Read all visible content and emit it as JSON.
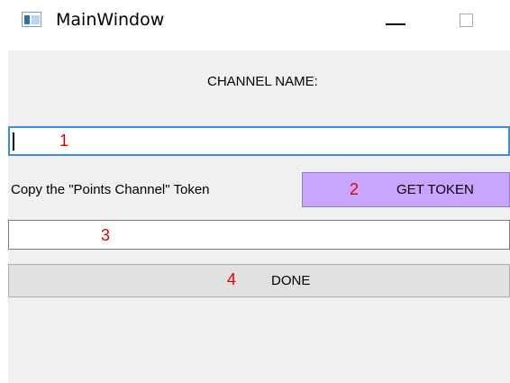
{
  "window": {
    "title": "MainWindow",
    "icon": "app-window-icon",
    "controls": [
      "minimize-icon",
      "maximize-icon"
    ]
  },
  "form": {
    "channel_label": "CHANNEL NAME:",
    "channel_input_value": "",
    "copy_instruction": "Copy the \"Points Channel\" Token",
    "get_token_label": "GET TOKEN",
    "token_input_value": "",
    "done_label": "DONE"
  },
  "annotations": {
    "marker_1": "1",
    "marker_2": "2",
    "marker_3": "3",
    "marker_4": "4"
  },
  "colors": {
    "focus_border": "#3a8ee6",
    "get_token_bg": "#c8a6ff",
    "marker": "#e00000",
    "client_bg": "#f0f0f0"
  }
}
